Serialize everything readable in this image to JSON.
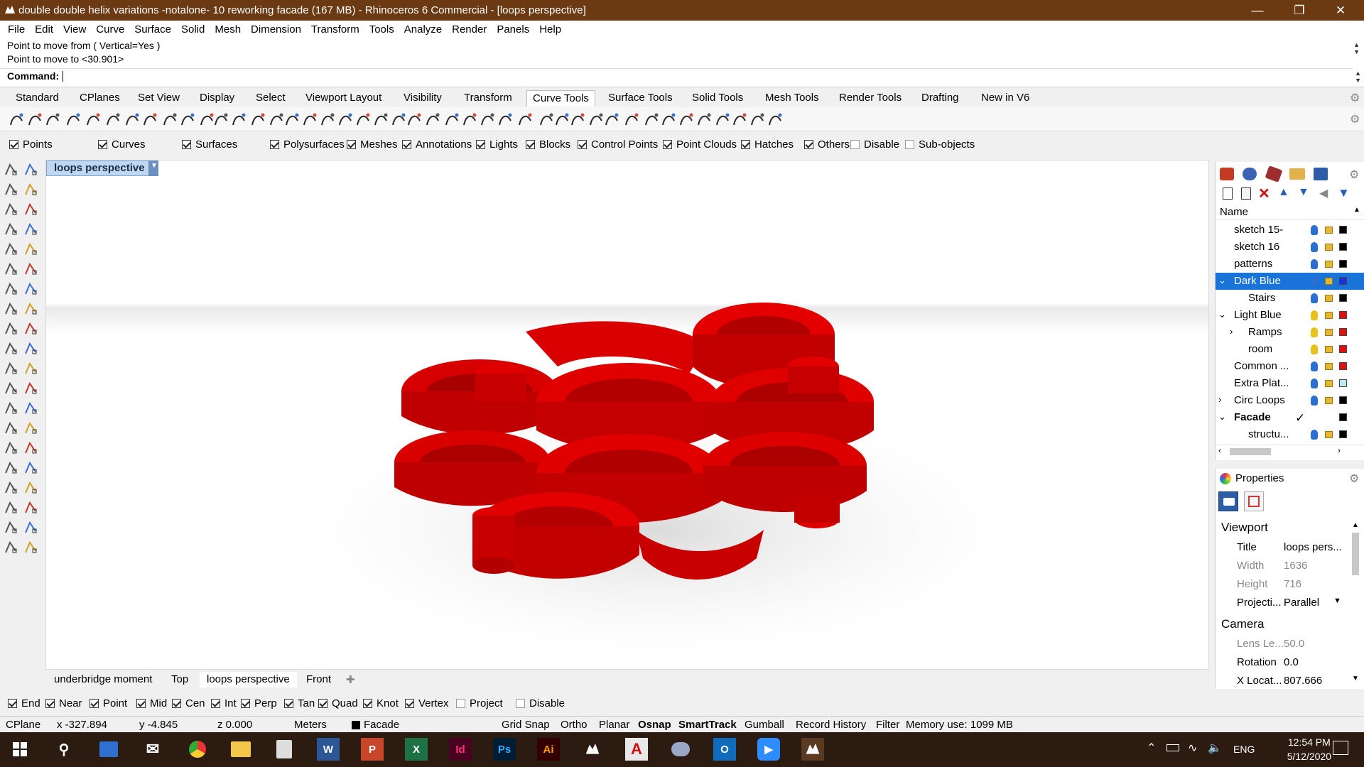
{
  "window": {
    "title": "double double helix variations -notalone- 10 reworking facade (167 MB) - Rhinoceros 6 Commercial - [loops perspective]"
  },
  "menu": [
    "File",
    "Edit",
    "View",
    "Curve",
    "Surface",
    "Solid",
    "Mesh",
    "Dimension",
    "Transform",
    "Tools",
    "Analyze",
    "Render",
    "Panels",
    "Help"
  ],
  "command": {
    "history": [
      "Point to move from ( Vertical=Yes )",
      "Point to move to <30.901>"
    ],
    "prompt_label": "Command:"
  },
  "toolbar_tabs": [
    "Standard",
    "CPlanes",
    "Set View",
    "Display",
    "Select",
    "Viewport Layout",
    "Visibility",
    "Transform",
    "Curve Tools",
    "Surface Tools",
    "Solid Tools",
    "Mesh Tools",
    "Render Tools",
    "Drafting",
    "New in V6"
  ],
  "active_toolbar_tab": "Curve Tools",
  "filters": [
    {
      "label": "Points",
      "checked": true
    },
    {
      "label": "Curves",
      "checked": true
    },
    {
      "label": "Surfaces",
      "checked": true
    },
    {
      "label": "Polysurfaces",
      "checked": true
    },
    {
      "label": "Meshes",
      "checked": true
    },
    {
      "label": "Annotations",
      "checked": true
    },
    {
      "label": "Lights",
      "checked": true
    },
    {
      "label": "Blocks",
      "checked": true
    },
    {
      "label": "Control Points",
      "checked": true
    },
    {
      "label": "Point Clouds",
      "checked": true
    },
    {
      "label": "Hatches",
      "checked": true
    },
    {
      "label": "Others",
      "checked": true
    },
    {
      "label": "Disable",
      "checked": false
    },
    {
      "label": "Sub-objects",
      "checked": false
    }
  ],
  "viewport": {
    "label": "loops perspective",
    "object_color": "#e20000"
  },
  "viewport_tabs": [
    "underbridge moment",
    "Top",
    "loops perspective",
    "Front"
  ],
  "active_viewport_tab": "loops perspective",
  "osnaps": [
    {
      "label": "End",
      "checked": true
    },
    {
      "label": "Near",
      "checked": true
    },
    {
      "label": "Point",
      "checked": true
    },
    {
      "label": "Mid",
      "checked": true
    },
    {
      "label": "Cen",
      "checked": true
    },
    {
      "label": "Int",
      "checked": true
    },
    {
      "label": "Perp",
      "checked": true
    },
    {
      "label": "Tan",
      "checked": true
    },
    {
      "label": "Quad",
      "checked": true
    },
    {
      "label": "Knot",
      "checked": true
    },
    {
      "label": "Vertex",
      "checked": true
    },
    {
      "label": "Project",
      "checked": false
    },
    {
      "label": "Disable",
      "checked": false
    }
  ],
  "status": {
    "cplane": "CPlane",
    "x": "x -327.894",
    "y": "y -4.845",
    "z": "z 0.000",
    "units": "Meters",
    "layer": "Facade",
    "grid_snap": "Grid Snap",
    "ortho": "Ortho",
    "planar": "Planar",
    "osnap": "Osnap",
    "smarttrack": "SmartTrack",
    "gumball": "Gumball",
    "record_history": "Record History",
    "filter": "Filter",
    "memory": "Memory use: 1099 MB"
  },
  "layers": {
    "header": "Name",
    "rows": [
      {
        "name": "sketch 15-",
        "indent": 1,
        "bulb": "#2a6fd1",
        "color": "#000000",
        "selected": false,
        "expander": ""
      },
      {
        "name": "sketch 16",
        "indent": 1,
        "bulb": "#2a6fd1",
        "color": "#000000",
        "selected": false,
        "expander": ""
      },
      {
        "name": "patterns",
        "indent": 1,
        "bulb": "#2a6fd1",
        "color": "#000000",
        "selected": false,
        "expander": ""
      },
      {
        "name": "Dark Blue",
        "indent": 1,
        "bulb": "#2a6fd1",
        "color": "#1b2fe0",
        "selected": true,
        "expander": "v"
      },
      {
        "name": "Stairs",
        "indent": 2,
        "bulb": "#2a6fd1",
        "color": "#000000",
        "selected": false,
        "expander": ""
      },
      {
        "name": "Light Blue",
        "indent": 1,
        "bulb": "#e8c21a",
        "color": "#e01010",
        "selected": false,
        "expander": "v"
      },
      {
        "name": "Ramps",
        "indent": 2,
        "bulb": "#e8c21a",
        "color": "#e01010",
        "selected": false,
        "expander": ">"
      },
      {
        "name": "room",
        "indent": 2,
        "bulb": "#e8c21a",
        "color": "#e01010",
        "selected": false,
        "expander": ""
      },
      {
        "name": "Common ...",
        "indent": 1,
        "bulb": "#2a6fd1",
        "color": "#e01010",
        "selected": false,
        "expander": ""
      },
      {
        "name": "Extra Plat...",
        "indent": 1,
        "bulb": "#2a6fd1",
        "color": "#bfe9f0",
        "selected": false,
        "expander": ""
      },
      {
        "name": "Circ Loops",
        "indent": 1,
        "bulb": "#2a6fd1",
        "color": "#000000",
        "selected": false,
        "expander": ">"
      },
      {
        "name": "Facade",
        "indent": 1,
        "bulb": "",
        "color": "#000000",
        "selected": false,
        "expander": "v",
        "current": true
      },
      {
        "name": "structu...",
        "indent": 2,
        "bulb": "#2a6fd1",
        "color": "#000000",
        "selected": false,
        "expander": ""
      }
    ]
  },
  "properties": {
    "title": "Properties",
    "viewport_section": "Viewport",
    "viewport_rows": [
      {
        "key": "Title",
        "value": "loops pers...",
        "dim": false
      },
      {
        "key": "Width",
        "value": "1636",
        "dim": true
      },
      {
        "key": "Height",
        "value": "716",
        "dim": true
      },
      {
        "key": "Projecti...",
        "value": "Parallel",
        "dim": false
      }
    ],
    "camera_section": "Camera",
    "camera_rows": [
      {
        "key": "Lens Le...",
        "value": "50.0",
        "dim": true
      },
      {
        "key": "Rotation",
        "value": "0.0",
        "dim": false
      },
      {
        "key": "X Locat...",
        "value": "807.666",
        "dim": false
      }
    ]
  },
  "taskbar": {
    "time": "12:54 PM",
    "date": "5/12/2020",
    "lang": "ENG"
  }
}
